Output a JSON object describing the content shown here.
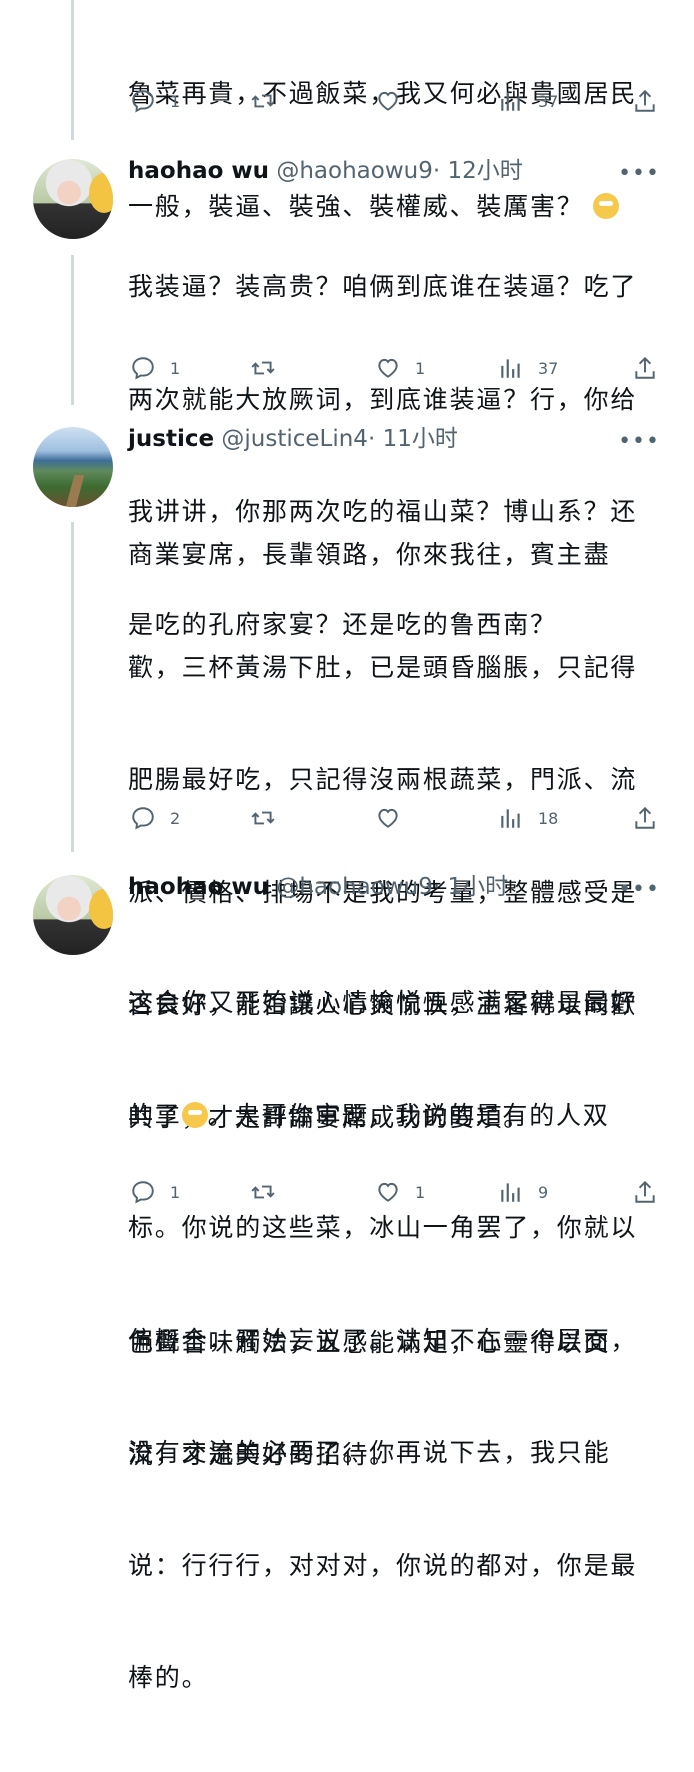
{
  "tweets": [
    {
      "text_lines": [
        "魯菜再貴，不過飯菜，我又何必與貴國居民",
        "一般，裝逼、裝強、裝權威、裝厲害？"
      ],
      "emoji": "laughing-tears",
      "actions": {
        "replies": "1",
        "retweets": "",
        "likes": "",
        "views": "37"
      }
    },
    {
      "name": "haohao wu",
      "handle": "@haohaowu9",
      "time": "· 12小时",
      "avatar": "user-photo-avatar",
      "text_lines": [
        "我装逼？装高贵？咱俩到底谁在装逼？吃了",
        "两次就能大放厥词，到底谁装逼？行，你给",
        "我讲讲，你那两次吃的福山菜？博山系？还",
        "是吃的孔府家宴？还是吃的鲁西南？"
      ],
      "actions": {
        "replies": "1",
        "retweets": "",
        "likes": "1",
        "views": "37"
      }
    },
    {
      "name": "justice",
      "handle": "@justiceLin4",
      "time": "· 11小时",
      "avatar": "landscape-avatar",
      "text_lines": [
        "商業宴席，長輩領路，你來我往，賓主盡",
        "歡，三杯黃湯下肚，已是頭昏腦脹，只記得",
        "肥腸最好吃，只記得沒兩根蔬菜，門派、流",
        "派、價格、排場不是我的考量，整體感受是",
        "否良好，能否讓人心爽愉快，主客得以同歡",
        "共享，才是評論宴席成功的要項。",
        "",
        "色聲香味觸法，五感能滿足，心靈得以交",
        "流，才是美好的招待。"
      ],
      "actions": {
        "replies": "2",
        "retweets": "",
        "likes": "",
        "views": "18"
      }
    },
    {
      "name": "haohao wu",
      "handle": "@haohaowu9",
      "time": "· 1小时",
      "avatar": "user-photo-avatar",
      "text_lines": [
        "这会你又开始说心情愉悦五感满足就是最好",
        "的了",
        "。大哥你审题，我说的是有的人双",
        "标。你说的这些菜，冰山一角罢了，你就以",
        "偏概全，开始妄议了。认知不在一个层面，",
        "没有交流的必要了。你再说下去，我只能",
        "说：行行行，对对对，你说的都对，你是最",
        "棒的。"
      ],
      "emoji": "eye-roll",
      "actions": {
        "replies": "1",
        "retweets": "",
        "likes": "1",
        "views": "9"
      }
    }
  ],
  "colors": {
    "text": "#0f1419",
    "muted": "#536471",
    "thread_line": "#cfd9de"
  },
  "icons": [
    "reply-icon",
    "retweet-icon",
    "like-icon",
    "views-icon",
    "share-icon",
    "more-icon"
  ]
}
